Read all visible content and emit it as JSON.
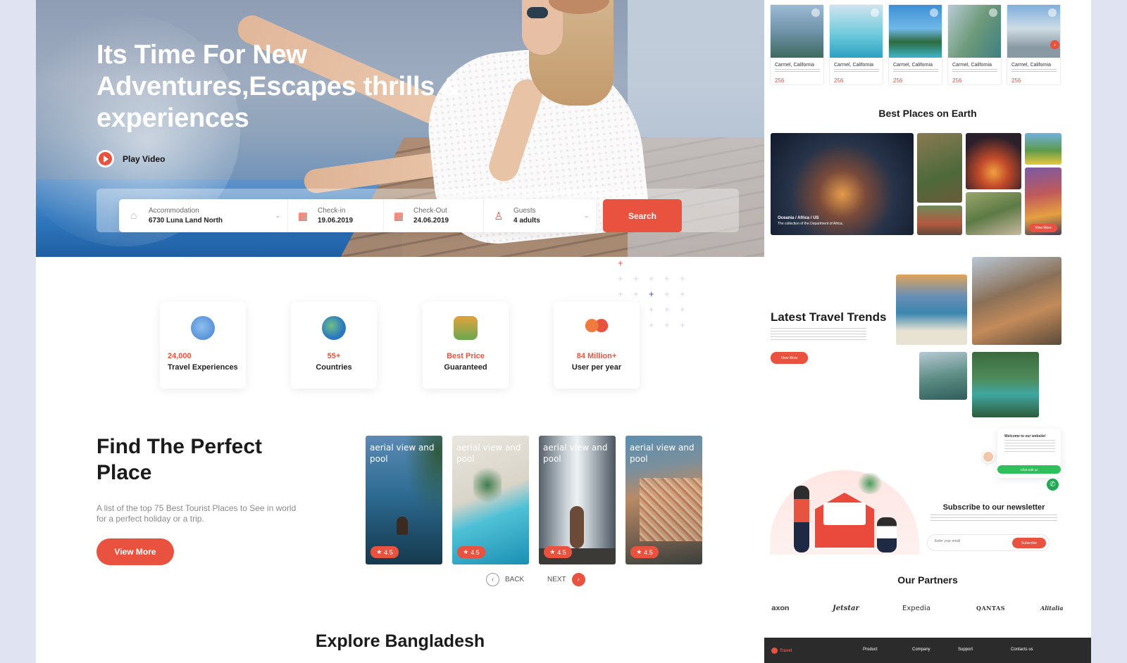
{
  "hero": {
    "headline": "Its Time For New Adventures,Escapes thrills & experiences",
    "play_label": "Play Video"
  },
  "search": {
    "accommodation_label": "Accommodation",
    "accommodation_value": "6730 Luna Land North",
    "checkin_label": "Check-in",
    "checkin_value": "19.06.2019",
    "checkout_label": "Check-Out",
    "checkout_value": "24.06.2019",
    "guests_label": "Guests",
    "guests_value": "4 adults",
    "button": "Search"
  },
  "stats": [
    {
      "value": "24,000",
      "label": "Travel Experiences"
    },
    {
      "value": "55+",
      "label": "Countries"
    },
    {
      "value": "Best Price",
      "label": "Guaranteed"
    },
    {
      "value": "84 Million+",
      "label": "User per year"
    }
  ],
  "perfect_place": {
    "title_line1": "Find The Perfect",
    "title_line2": "Place",
    "description": "A list of the top 75 Best Tourist Places to See in world for a perfect holiday or a trip.",
    "button": "View More",
    "cards": [
      {
        "title": "aerial view and pool",
        "rating": "4.5"
      },
      {
        "title": "aerial view and pool",
        "rating": "4.5"
      },
      {
        "title": "aerial view and pool",
        "rating": "4.5"
      },
      {
        "title": "aerial view and pool",
        "rating": "4.5"
      }
    ],
    "back": "BACK",
    "next": "NEXT"
  },
  "explore_title": "Explore Bangladesh",
  "side": {
    "mini_cards": [
      {
        "title": "Carmel, California",
        "price": "256"
      },
      {
        "title": "Carmel, California",
        "price": "256"
      },
      {
        "title": "Carmel, California",
        "price": "256"
      },
      {
        "title": "Carmel, California",
        "price": "256"
      },
      {
        "title": "Carmel, California",
        "price": "256"
      }
    ],
    "best_places_title": "Best Places on Earth",
    "best_places_caption": "Oceania / Africa / US",
    "best_places_subcaption": "The collection of the Department of Africa.",
    "best_places_btn": "View More",
    "trends_title": "Latest Travel Trends",
    "trends_btn": "View More",
    "welcome_title": "Welcome to our website!",
    "chat_btn": "Chat with us",
    "newsletter_title": "Subscribe to our newsletter",
    "newsletter_placeholder": "Enter your email",
    "newsletter_btn": "Subscribe",
    "partners_title": "Our Partners",
    "partners": [
      "axon",
      "Jetstar",
      "Expedia",
      "QANTAS",
      "Alitalia"
    ],
    "footer_brand": "Travel",
    "footer_links": [
      "Product",
      "Company",
      "Support",
      "Contacts us"
    ]
  },
  "colors": {
    "accent": "#e8523f",
    "whatsapp": "#1ea952",
    "chat": "#2fc05b",
    "footer": "#2b2b2b"
  }
}
